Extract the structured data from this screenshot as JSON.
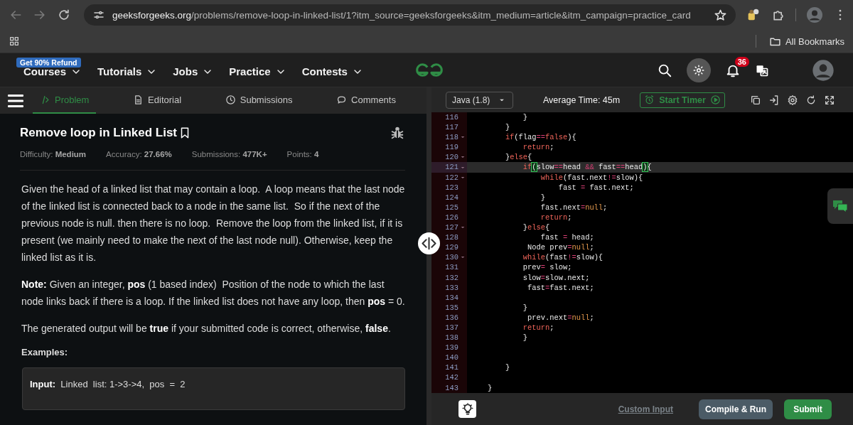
{
  "browser": {
    "url_host": "geeksforgeeks.org",
    "url_path": "/problems/remove-loop-in-linked-list/1?itm_source=geeksforgeeks&itm_medium=article&itm_campaign=practice_card",
    "bookmarks_folder": "All Bookmarks"
  },
  "site_nav": {
    "promo_badge": "Get 90% Refund",
    "menu": [
      {
        "label": "Courses"
      },
      {
        "label": "Tutorials"
      },
      {
        "label": "Jobs"
      },
      {
        "label": "Practice"
      },
      {
        "label": "Contests"
      }
    ],
    "notification_count": "36"
  },
  "problem_tabs": [
    {
      "label": "Problem",
      "selected": true,
      "kind": "code"
    },
    {
      "label": "Editorial",
      "selected": false,
      "kind": "doc"
    },
    {
      "label": "Submissions",
      "selected": false,
      "kind": "clock"
    },
    {
      "label": "Comments",
      "selected": false,
      "kind": "comment"
    }
  ],
  "problem": {
    "title": "Remove loop in Linked List",
    "meta": [
      "Difficulty: **Medium**",
      "Accuracy: **27.66%**",
      "Submissions: **477K+**",
      "Points: **4**"
    ],
    "paragraphs": [
      "Given the head of a linked list that may contain a loop.  A loop means that the last node of the linked list is connected back to a node in the same list.  So if the next of the previous node is null. then there is no loop.  Remove the loop from the linked list, if it is present (we mainly need to make the next of the last node null). Otherwise, keep the linked list as it is.",
      "**Note:** Given an integer, **pos** (1 based index)  Position of the node to which the last node links back if there is a loop. If the linked list does not have any loop, then **pos** = 0.",
      "The generated output will be **true** if your submitted code is correct, otherwise, **false**."
    ],
    "examples_heading": "Examples:",
    "example_input": "**Input:**  Linked  list: 1->3->4,  pos  =  2"
  },
  "editor": {
    "language": "Java (1.8)",
    "average_time": "Average Time: 45m",
    "timer_button": "Start Timer",
    "lines": [
      {
        "number": "116",
        "fold": false,
        "current": false,
        "code": [
          {
            "kind": "plain",
            "text": "            }"
          }
        ]
      },
      {
        "number": "117",
        "fold": false,
        "current": false,
        "code": [
          {
            "kind": "plain",
            "text": "        }"
          }
        ]
      },
      {
        "number": "118",
        "fold": true,
        "current": false,
        "code": [
          {
            "kind": "keyword",
            "text": "        if"
          },
          {
            "kind": "plain",
            "text": "(flag"
          },
          {
            "kind": "operator",
            "text": "=="
          },
          {
            "kind": "keyword",
            "text": "false"
          },
          {
            "kind": "plain",
            "text": "){"
          }
        ]
      },
      {
        "number": "119",
        "fold": false,
        "current": false,
        "code": [
          {
            "kind": "keyword",
            "text": "            return"
          },
          {
            "kind": "plain",
            "text": ";"
          }
        ]
      },
      {
        "number": "120",
        "fold": true,
        "current": false,
        "code": [
          {
            "kind": "plain",
            "text": "        }"
          },
          {
            "kind": "keyword",
            "text": "else"
          },
          {
            "kind": "plain",
            "text": "{"
          }
        ]
      },
      {
        "number": "121",
        "fold": true,
        "current": true,
        "code": [
          {
            "kind": "keyword",
            "text": "            if"
          },
          {
            "kind": "match",
            "text": "("
          },
          {
            "kind": "plain",
            "text": "slow"
          },
          {
            "kind": "operator",
            "text": "=="
          },
          {
            "kind": "plain",
            "text": "head "
          },
          {
            "kind": "operator",
            "text": "&&"
          },
          {
            "kind": "plain",
            "text": " fast"
          },
          {
            "kind": "operator",
            "text": "=="
          },
          {
            "kind": "plain",
            "text": "head"
          },
          {
            "kind": "match",
            "text": ")"
          },
          {
            "kind": "plain",
            "text": "{"
          }
        ]
      },
      {
        "number": "122",
        "fold": true,
        "current": false,
        "code": [
          {
            "kind": "keyword",
            "text": "                while"
          },
          {
            "kind": "plain",
            "text": "(fast.next"
          },
          {
            "kind": "operator",
            "text": "!="
          },
          {
            "kind": "plain",
            "text": "slow){"
          }
        ]
      },
      {
        "number": "123",
        "fold": false,
        "current": false,
        "code": [
          {
            "kind": "plain",
            "text": "                    fast "
          },
          {
            "kind": "operator",
            "text": "="
          },
          {
            "kind": "plain",
            "text": " fast.next;"
          }
        ]
      },
      {
        "number": "124",
        "fold": false,
        "current": false,
        "code": [
          {
            "kind": "plain",
            "text": "                }"
          }
        ]
      },
      {
        "number": "125",
        "fold": false,
        "current": false,
        "code": [
          {
            "kind": "plain",
            "text": "                fast.next"
          },
          {
            "kind": "operator",
            "text": "="
          },
          {
            "kind": "literal",
            "text": "null"
          },
          {
            "kind": "plain",
            "text": ";"
          }
        ]
      },
      {
        "number": "126",
        "fold": false,
        "current": false,
        "code": [
          {
            "kind": "keyword",
            "text": "                return"
          },
          {
            "kind": "plain",
            "text": ";"
          }
        ]
      },
      {
        "number": "127",
        "fold": true,
        "current": false,
        "code": [
          {
            "kind": "plain",
            "text": "            }"
          },
          {
            "kind": "keyword",
            "text": "else"
          },
          {
            "kind": "plain",
            "text": "{"
          }
        ]
      },
      {
        "number": "128",
        "fold": false,
        "current": false,
        "code": [
          {
            "kind": "plain",
            "text": "                fast "
          },
          {
            "kind": "operator",
            "text": "="
          },
          {
            "kind": "plain",
            "text": " head;"
          }
        ]
      },
      {
        "number": "129",
        "fold": false,
        "current": false,
        "code": [
          {
            "kind": "plain",
            "text": "             Node prev"
          },
          {
            "kind": "operator",
            "text": "="
          },
          {
            "kind": "literal",
            "text": "null"
          },
          {
            "kind": "plain",
            "text": ";"
          }
        ]
      },
      {
        "number": "130",
        "fold": true,
        "current": false,
        "code": [
          {
            "kind": "keyword",
            "text": "            while"
          },
          {
            "kind": "plain",
            "text": "(fast"
          },
          {
            "kind": "operator",
            "text": "!="
          },
          {
            "kind": "plain",
            "text": "slow){"
          }
        ]
      },
      {
        "number": "131",
        "fold": false,
        "current": false,
        "code": [
          {
            "kind": "plain",
            "text": "            prev"
          },
          {
            "kind": "operator",
            "text": "="
          },
          {
            "kind": "plain",
            "text": " slow;"
          }
        ]
      },
      {
        "number": "132",
        "fold": false,
        "current": false,
        "code": [
          {
            "kind": "plain",
            "text": "            slow"
          },
          {
            "kind": "operator",
            "text": "="
          },
          {
            "kind": "plain",
            "text": "slow.next;"
          }
        ]
      },
      {
        "number": "133",
        "fold": false,
        "current": false,
        "code": [
          {
            "kind": "plain",
            "text": "             fast"
          },
          {
            "kind": "operator",
            "text": "="
          },
          {
            "kind": "plain",
            "text": "fast.next;"
          }
        ]
      },
      {
        "number": "134",
        "fold": false,
        "current": false
      },
      {
        "number": "135",
        "fold": false,
        "current": false,
        "code": [
          {
            "kind": "plain",
            "text": "            }"
          }
        ]
      },
      {
        "number": "136",
        "fold": false,
        "current": false,
        "code": [
          {
            "kind": "plain",
            "text": "             prev.next"
          },
          {
            "kind": "operator",
            "text": "="
          },
          {
            "kind": "literal",
            "text": "null"
          },
          {
            "kind": "plain",
            "text": ";"
          }
        ]
      },
      {
        "number": "137",
        "fold": false,
        "current": false,
        "code": [
          {
            "kind": "keyword",
            "text": "            return"
          },
          {
            "kind": "plain",
            "text": ";"
          }
        ]
      },
      {
        "number": "138",
        "fold": false,
        "current": false,
        "code": [
          {
            "kind": "plain",
            "text": "            }"
          }
        ]
      },
      {
        "number": "139",
        "fold": false,
        "current": false
      },
      {
        "number": "140",
        "fold": false,
        "current": false
      },
      {
        "number": "141",
        "fold": false,
        "current": false,
        "code": [
          {
            "kind": "plain",
            "text": "        }"
          }
        ]
      },
      {
        "number": "142",
        "fold": false,
        "current": false
      },
      {
        "number": "143",
        "fold": false,
        "current": false,
        "code": [
          {
            "kind": "plain",
            "text": "    }"
          }
        ]
      }
    ]
  },
  "footer": {
    "custom_input": "Custom Input",
    "buttons": [
      {
        "label": "Compile & Run",
        "kind": "secondary"
      },
      {
        "label": "Submit",
        "kind": "primary"
      }
    ]
  }
}
